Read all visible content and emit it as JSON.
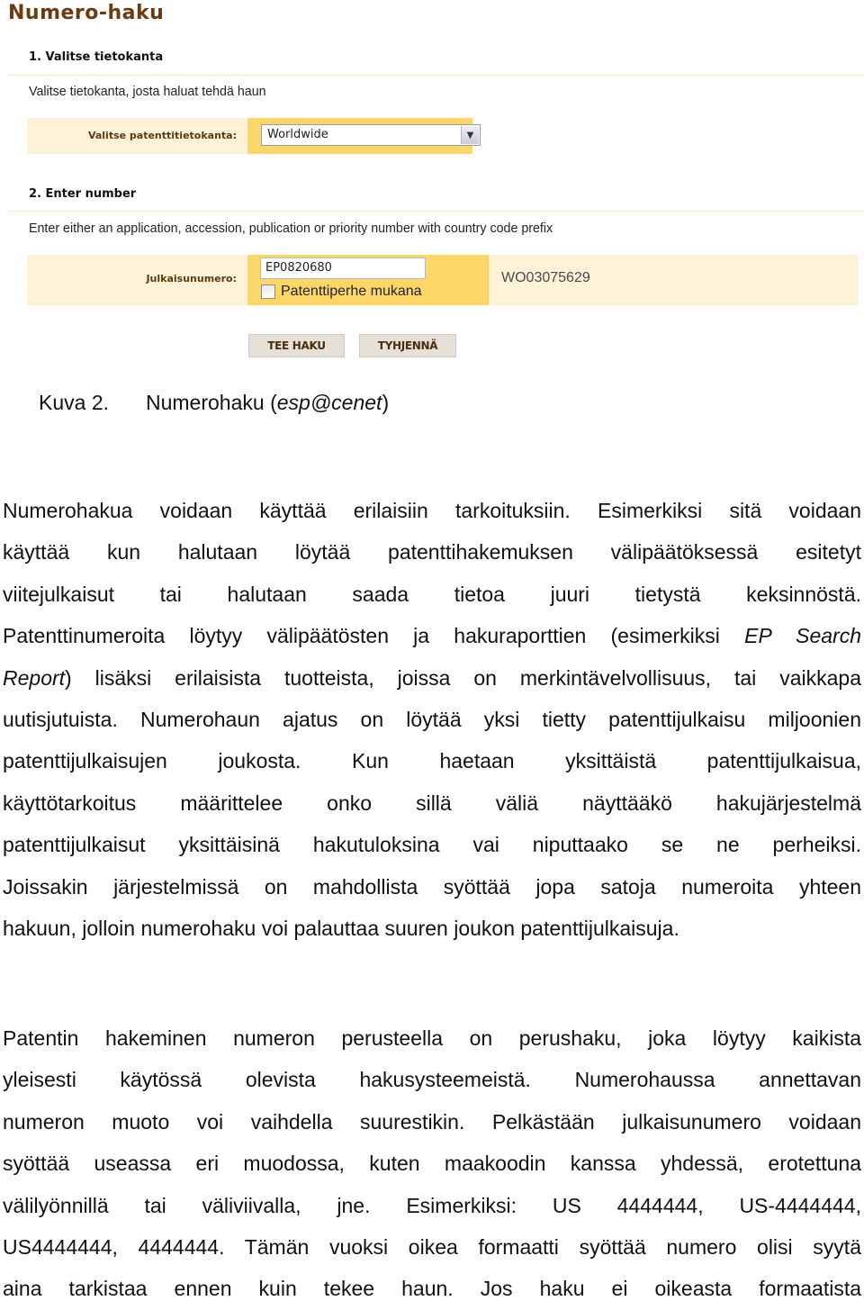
{
  "screenshot": {
    "page_title": "Numero-haku",
    "step1": {
      "title": "1. Valitse tietokanta",
      "description": "Valitse tietokanta, josta haluat tehdä haun",
      "database_label": "Valitse patenttitietokanta:",
      "database_selected": "Worldwide"
    },
    "step2": {
      "title": "2. Enter number",
      "description": "Enter either an application, accession, publication or priority number with country code prefix",
      "number_label": "Julkaisunumero:",
      "number_value": "EP0820680",
      "family_checkbox_label": "Patenttiperhe mukana",
      "family_checkbox_checked": false,
      "example_number": "WO03075629"
    },
    "buttons": {
      "search": "TEE HAKU",
      "clear": "TYHJENNÄ"
    },
    "colors": {
      "title_brown": "#6b3a0e",
      "label_bg": "#fef3d6",
      "field_bg": "#fcd767",
      "button_bg": "#e5e0d8"
    }
  },
  "caption": {
    "number": "Kuva 2.",
    "text_plain": "Numerohaku (",
    "text_italic": "esp@cenet",
    "text_close": ")"
  },
  "paragraph1": {
    "lines": [
      "Numerohakua voidaan käyttää erilaisiin tarkoituksiin. Esimerkiksi sitä voidaan",
      "käyttää kun halutaan löytää patenttihakemuksen välipäätöksessä esitetyt",
      "viitejulkaisut tai halutaan saada tietoa juuri tietystä keksinnöstä.",
      "Patenttinumeroita löytyy välipäätösten ja hakuraporttien (esimerkiksi ",
      "EP Search",
      "Report",
      ") lisäksi erilaisista tuotteista, joissa on merkintävelvollisuus, tai vaikkapa",
      "uutisjutuista. Numerohaun ajatus on löytää yksi tietty patenttijulkaisu miljoonien",
      "patenttijulkaisujen joukosta. Kun haetaan yksittäistä patenttijulkaisua,",
      "käyttötarkoitus määrittelee onko sillä väliä näyttääkö hakujärjestelmä",
      "patenttijulkaisut yksittäisinä hakutuloksina vai niputtaako se ne perheiksi.",
      "Joissakin järjestelmissä on mahdollista syöttää jopa satoja numeroita yhteen",
      "hakuun, jolloin numerohaku voi palauttaa suuren joukon patenttijulkaisuja."
    ]
  },
  "paragraph2": {
    "lines": [
      "Patentin hakeminen numeron perusteella on perushaku, joka löytyy kaikista",
      "yleisesti käytössä olevista hakusysteemeistä. Numerohaussa annettavan",
      "numeron muoto voi vaihdella suurestikin. Pelkästään julkaisunumero voidaan",
      "syöttää useassa eri muodossa, kuten maakoodin kanssa yhdessä, erotettuna",
      "välilyönnillä tai väliviivalla, jne. Esimerkiksi: US 4444444, US-4444444,",
      "US4444444, 4444444. Tämän vuoksi oikea formaatti syöttää numero olisi syytä",
      "aina tarkistaa ennen kuin tekee haun. Jos haku ei oikeasta formaatista"
    ]
  }
}
